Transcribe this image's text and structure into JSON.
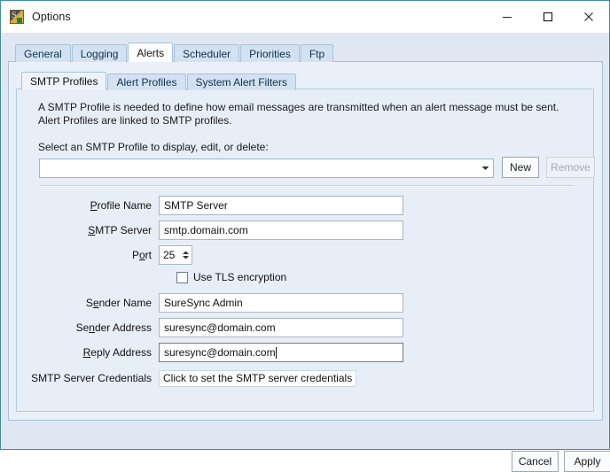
{
  "window": {
    "title": "Options",
    "icon": "app-icon",
    "minimize_label": "Minimize",
    "maximize_label": "Maximize",
    "close_label": "Close"
  },
  "outer_tabs": [
    {
      "label": "General",
      "active": false
    },
    {
      "label": "Logging",
      "active": false
    },
    {
      "label": "Alerts",
      "active": true
    },
    {
      "label": "Scheduler",
      "active": false
    },
    {
      "label": "Priorities",
      "active": false
    },
    {
      "label": "Ftp",
      "active": false
    }
  ],
  "inner_tabs": [
    {
      "label": "SMTP Profiles",
      "active": true
    },
    {
      "label": "Alert Profiles",
      "active": false
    },
    {
      "label": "System Alert Filters",
      "active": false
    }
  ],
  "smtp_panel": {
    "description": "A SMTP Profile is needed to define how email messages are transmitted when an alert message must be sent. Alert Profiles are linked to SMTP profiles.",
    "select_label": "Select an SMTP Profile to display, edit, or delete:",
    "profile_combo": {
      "value": "",
      "placeholder": ""
    },
    "new_button": "New",
    "remove_button": "Remove",
    "remove_enabled": false,
    "fields": {
      "profile_name": {
        "label_pre": "",
        "label_accel": "P",
        "label_post": "rofile Name",
        "value": "SMTP Server"
      },
      "smtp_server": {
        "label_pre": "",
        "label_accel": "S",
        "label_post": "MTP Server",
        "value": "smtp.domain.com"
      },
      "port": {
        "label_pre": "P",
        "label_accel": "o",
        "label_post": "rt",
        "value": "25"
      },
      "sender_name": {
        "label_pre": "S",
        "label_accel": "e",
        "label_post": "nder Name",
        "value": "SureSync Admin"
      },
      "sender_address": {
        "label_pre": "Se",
        "label_accel": "n",
        "label_post": "der Address",
        "value": "suresync@domain.com"
      },
      "reply_address": {
        "label_pre": "",
        "label_accel": "R",
        "label_post": "eply Address",
        "value": "suresync@domain.com"
      }
    },
    "tls_checkbox": {
      "label": "Use TLS encryption",
      "checked": false
    },
    "credentials": {
      "label": "SMTP Server Credentials",
      "value": "Click to set the SMTP server credentials"
    }
  },
  "footer": {
    "cancel_label": "Cancel",
    "apply_label": "Apply"
  },
  "colors": {
    "window_border": "#3f8ba3",
    "client_bg": "#dfe7f3",
    "panel_bg": "#eaf0f9",
    "inner_panel_bg": "#e7eef8",
    "tab_inactive": "#d2e2f2",
    "tab_active": "#ffffff",
    "field_bg": "#ffffff"
  }
}
